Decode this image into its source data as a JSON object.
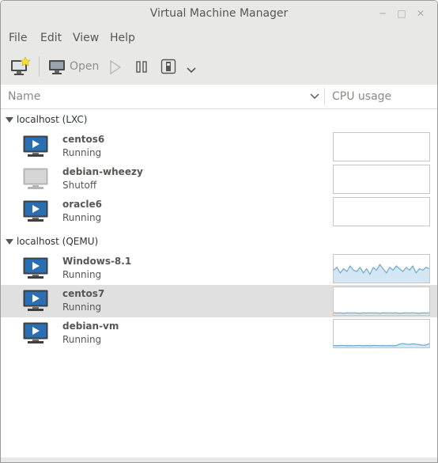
{
  "window": {
    "title": "Virtual Machine Manager"
  },
  "menu": {
    "file": "File",
    "edit": "Edit",
    "view": "View",
    "help": "Help"
  },
  "toolbar": {
    "open_label": "Open"
  },
  "columns": {
    "name": "Name",
    "cpu": "CPU usage"
  },
  "groups": [
    {
      "label": "localhost (LXC)",
      "vms": [
        {
          "name": "centos6",
          "status": "Running",
          "state": "running",
          "cpu": []
        },
        {
          "name": "debian-wheezy",
          "status": "Shutoff",
          "state": "shutoff",
          "cpu": []
        },
        {
          "name": "oracle6",
          "status": "Running",
          "state": "running",
          "cpu": []
        }
      ]
    },
    {
      "label": "localhost (QEMU)",
      "vms": [
        {
          "name": "Windows-8.1",
          "status": "Running",
          "state": "running",
          "cpu": [
            0.45,
            0.55,
            0.35,
            0.5,
            0.4,
            0.6,
            0.45,
            0.4,
            0.55,
            0.35,
            0.5,
            0.3,
            0.55,
            0.45,
            0.65,
            0.5,
            0.35,
            0.55,
            0.45,
            0.6,
            0.5,
            0.4,
            0.55,
            0.45,
            0.6,
            0.35,
            0.5,
            0.45,
            0.55,
            0.5
          ]
        },
        {
          "name": "centos7",
          "status": "Running",
          "state": "running",
          "selected": true,
          "cpu": [
            0.08,
            0.07,
            0.08,
            0.06,
            0.08,
            0.07,
            0.08,
            0.07,
            0.06,
            0.08,
            0.07,
            0.08,
            0.07,
            0.08,
            0.06,
            0.08,
            0.07,
            0.08,
            0.07,
            0.08,
            0.06,
            0.07,
            0.08,
            0.07,
            0.08,
            0.07,
            0.06,
            0.08,
            0.07,
            0.08
          ]
        },
        {
          "name": "debian-vm",
          "status": "Running",
          "state": "running",
          "cpu": [
            0.07,
            0.06,
            0.07,
            0.07,
            0.06,
            0.07,
            0.06,
            0.07,
            0.07,
            0.06,
            0.07,
            0.06,
            0.07,
            0.07,
            0.06,
            0.07,
            0.06,
            0.07,
            0.06,
            0.07,
            0.12,
            0.14,
            0.12,
            0.11,
            0.13,
            0.12,
            0.1,
            0.08,
            0.09,
            0.14
          ]
        }
      ]
    }
  ],
  "colors": {
    "graph_line": "#6fa8cf",
    "graph_fill": "#d4e6f4",
    "accent": "#2a6fb4"
  }
}
